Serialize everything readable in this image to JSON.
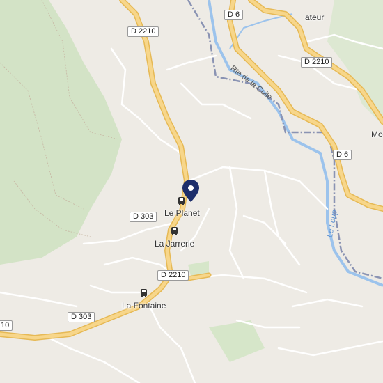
{
  "map": {
    "route_shields": [
      "D 6",
      "D 2210",
      "D 2210",
      "D 303",
      "D 2210",
      "D 303",
      "D 6",
      "10"
    ],
    "places": [
      "Le Planet",
      "La Jarrerie",
      "La Fontaine",
      "Mo",
      "ateur"
    ],
    "road_name": "Rte de la Colle",
    "river_name": "Le Loup",
    "colors": {
      "background": "#eeebe5",
      "forest": "#d3e3c6",
      "main_road": "#f7d68a",
      "main_road_casing": "#e6b955",
      "minor_road": "#ffffff",
      "river": "#9cc3ec",
      "boundary": "#8a93b3",
      "marker": "#1d2e6b"
    },
    "icons": [
      "map-pin-icon",
      "bus-stop-icon",
      "bus-stop-icon",
      "bus-stop-icon"
    ]
  }
}
